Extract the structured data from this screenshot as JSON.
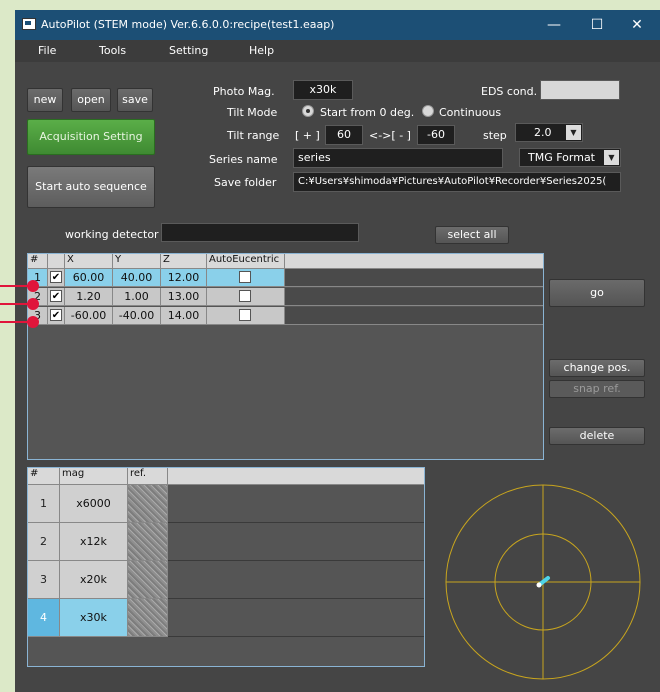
{
  "window": {
    "title": "AutoPilot (STEM mode) Ver.6.6.0.0:recipe(test1.eaap)",
    "controls": [
      "—",
      "☐",
      "✕"
    ]
  },
  "menu": [
    "File",
    "Tools",
    "Setting",
    "Help"
  ],
  "toolbar": {
    "new": "new",
    "open": "open",
    "save": "save",
    "acquisition": "Acquisition Setting",
    "start": "Start auto sequence"
  },
  "form": {
    "photo_mag_label": "Photo Mag.",
    "photo_mag_value": "x30k",
    "eds_label": "EDS cond.",
    "eds_value": "",
    "tilt_mode_label": "Tilt Mode",
    "tilt_mode_opt1": "Start from 0 deg.",
    "tilt_mode_opt2": "Continuous",
    "tilt_mode_selected": "Start from 0 deg.",
    "tilt_range_label": "Tilt range",
    "plus_label": "[ + ]",
    "plus_value": "60",
    "arrow_label": "<->[ - ]",
    "minus_value": "-60",
    "step_label": "step",
    "step_value": "2.0",
    "series_label": "Series name",
    "series_value": "series",
    "format_value": "TMG Format",
    "save_folder_label": "Save folder",
    "save_folder_value": "C:¥Users¥shimoda¥Pictures¥AutoPilot¥Recorder¥Series2025(",
    "working_detector_label": "working detector",
    "working_detector_value": "",
    "select_all": "select all"
  },
  "positions": {
    "columns": [
      "#",
      "",
      "X",
      "Y",
      "Z",
      "AutoEucentric"
    ],
    "rows": [
      {
        "n": "1",
        "checked": true,
        "x": "60.00",
        "y": "40.00",
        "z": "12.00",
        "auto": false
      },
      {
        "n": "2",
        "checked": true,
        "x": "1.20",
        "y": "1.00",
        "z": "13.00",
        "auto": false
      },
      {
        "n": "3",
        "checked": true,
        "x": "-60.00",
        "y": "-40.00",
        "z": "14.00",
        "auto": false
      }
    ]
  },
  "side_buttons": {
    "go": "go",
    "change_pos": "change pos.",
    "snap_ref": "snap ref.",
    "delete": "delete"
  },
  "mags": {
    "columns": [
      "#",
      "mag",
      "ref."
    ],
    "rows": [
      {
        "n": "1",
        "mag": "x6000"
      },
      {
        "n": "2",
        "mag": "x12k"
      },
      {
        "n": "3",
        "mag": "x20k"
      },
      {
        "n": "4",
        "mag": "x30k",
        "selected": true
      }
    ]
  },
  "colors": {
    "accent_green": "#4e9a3e",
    "title_blue": "#1c4f75",
    "marker_red": "#e0153b",
    "circle_yellow": "#c8a51e"
  }
}
